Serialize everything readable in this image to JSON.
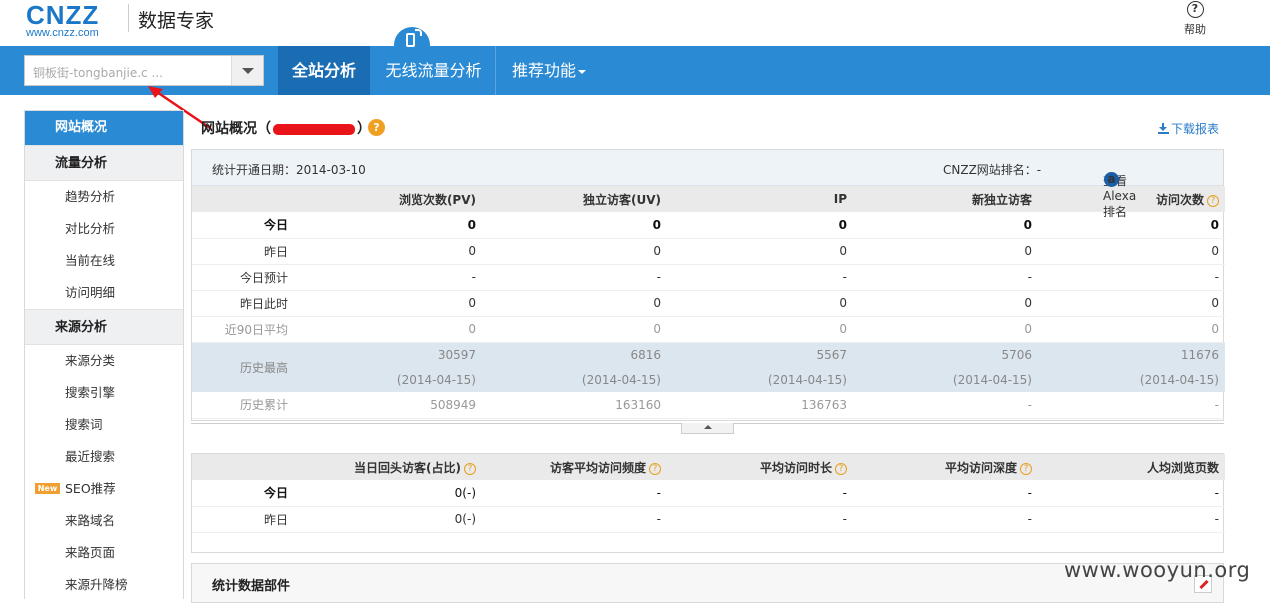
{
  "header": {
    "logo_main": "CNZZ",
    "logo_sub": "www.cnzz.com",
    "product_name": "数据专家",
    "help_label": "帮助"
  },
  "nav": {
    "site_select_value": "铜板街-tongbanjie.c ...",
    "tabs": [
      {
        "label": "全站分析",
        "active": true
      },
      {
        "label": "无线流量分析",
        "active": false
      },
      {
        "label": "推荐功能",
        "active": false
      }
    ]
  },
  "sidebar": {
    "items": [
      {
        "label": "网站概况",
        "type": "active"
      },
      {
        "label": "流量分析",
        "type": "group"
      },
      {
        "label": "趋势分析",
        "type": "sub"
      },
      {
        "label": "对比分析",
        "type": "sub"
      },
      {
        "label": "当前在线",
        "type": "sub"
      },
      {
        "label": "访问明细",
        "type": "sub"
      },
      {
        "label": "来源分析",
        "type": "group"
      },
      {
        "label": "来源分类",
        "type": "sub"
      },
      {
        "label": "搜索引擎",
        "type": "sub"
      },
      {
        "label": "搜索词",
        "type": "sub"
      },
      {
        "label": "最近搜索",
        "type": "sub"
      },
      {
        "label": "SEO推荐",
        "type": "sub",
        "badge": "New"
      },
      {
        "label": "来路域名",
        "type": "sub"
      },
      {
        "label": "来路页面",
        "type": "sub"
      },
      {
        "label": "来源升降榜",
        "type": "sub"
      }
    ]
  },
  "main": {
    "title_prefix": "网站概况（",
    "title_suffix": "）",
    "download_label": "下载报表",
    "start_date_label": "统计开通日期：2014-03-10",
    "rank_label": "CNZZ网站排名：-",
    "alexa_label": "查看Alexa排名"
  },
  "overview_table": {
    "headers": [
      "浏览次数(PV)",
      "独立访客(UV)",
      "IP",
      "新独立访客",
      "访问次数"
    ],
    "rows": [
      {
        "label": "今日",
        "values": [
          "0",
          "0",
          "0",
          "0",
          "0"
        ]
      },
      {
        "label": "昨日",
        "values": [
          "0",
          "0",
          "0",
          "0",
          "0"
        ]
      },
      {
        "label": "今日预计",
        "values": [
          "-",
          "-",
          "-",
          "-",
          "-"
        ]
      },
      {
        "label": "昨日此时",
        "values": [
          "0",
          "0",
          "0",
          "0",
          "0"
        ]
      },
      {
        "label": "近90日平均",
        "values": [
          "0",
          "0",
          "0",
          "0",
          "0"
        ]
      }
    ],
    "history_max": {
      "label": "历史最高",
      "values": [
        "30597",
        "6816",
        "5567",
        "5706",
        "11676"
      ],
      "dates": [
        "(2014-04-15)",
        "(2014-04-15)",
        "(2014-04-15)",
        "(2014-04-15)",
        "(2014-04-15)"
      ]
    },
    "history_total": {
      "label": "历史累计",
      "values": [
        "508949",
        "163160",
        "136763",
        "-",
        "-"
      ]
    }
  },
  "visit_table": {
    "headers": [
      "当日回头访客(占比)",
      "访客平均访问频度",
      "平均访问时长",
      "平均访问深度",
      "人均浏览页数"
    ],
    "rows": [
      {
        "label": "今日",
        "values": [
          "0(-)",
          "-",
          "-",
          "-",
          "-"
        ]
      },
      {
        "label": "昨日",
        "values": [
          "0(-)",
          "-",
          "-",
          "-",
          "-"
        ]
      }
    ]
  },
  "widget": {
    "title": "统计数据部件"
  },
  "watermark": "www.wooyun.org"
}
